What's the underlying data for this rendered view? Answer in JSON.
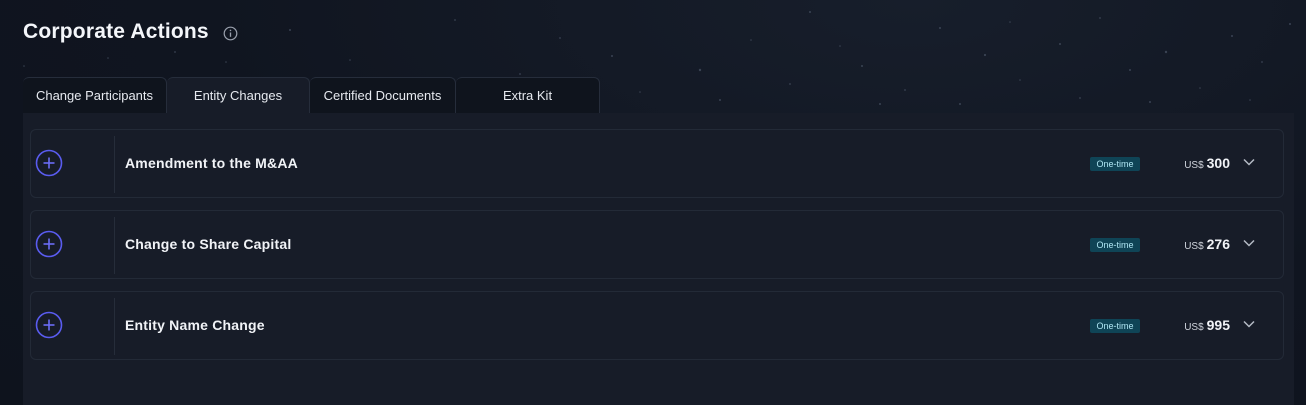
{
  "page": {
    "title": "Corporate Actions",
    "info_icon": "info-icon"
  },
  "tabs": [
    {
      "label": "Change Participants",
      "active": false
    },
    {
      "label": "Entity Changes",
      "active": true
    },
    {
      "label": "Certified Documents",
      "active": false
    },
    {
      "label": "Extra Kit",
      "active": false
    }
  ],
  "items": [
    {
      "title": "Amendment to the M&AA",
      "badge": "One-time",
      "currency": "US$",
      "amount": "300",
      "add_icon": "plus-circle-icon",
      "expand_icon": "chevron-down-icon"
    },
    {
      "title": "Change to Share Capital",
      "badge": "One-time",
      "currency": "US$",
      "amount": "276",
      "add_icon": "plus-circle-icon",
      "expand_icon": "chevron-down-icon"
    },
    {
      "title": "Entity Name Change",
      "badge": "One-time",
      "currency": "US$",
      "amount": "995",
      "add_icon": "plus-circle-icon",
      "expand_icon": "chevron-down-icon"
    }
  ],
  "colors": {
    "accent": "#5a5cf0",
    "badge_bg": "#0f4456",
    "badge_text": "#aee6f3",
    "background": "#0f141f",
    "panel": "#171c28"
  }
}
